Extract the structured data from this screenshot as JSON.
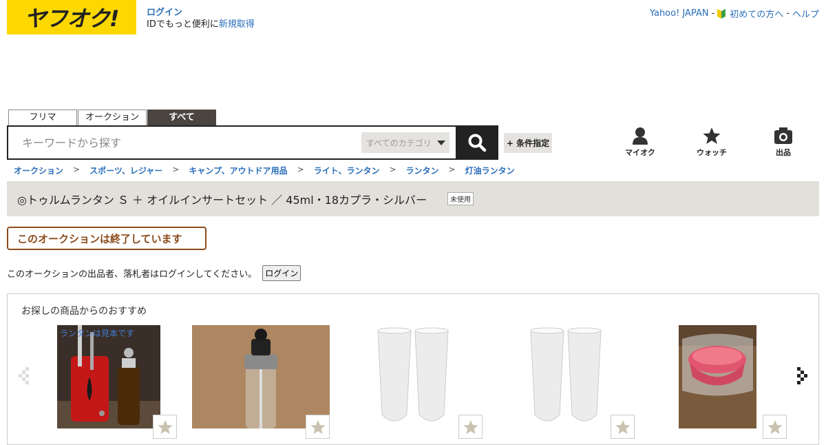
{
  "header": {
    "logo_text": "ヤフオク!",
    "login_label": "ログイン",
    "id_text": "IDでもっと便利に",
    "register_label": "新規取得",
    "top_links": [
      "Yahoo! JAPAN",
      "初めての方へ",
      "ヘルプ"
    ]
  },
  "tabs": [
    {
      "label": "フリマ",
      "active": false
    },
    {
      "label": "オークション",
      "active": false
    },
    {
      "label": "すべて",
      "active": true
    }
  ],
  "search": {
    "placeholder": "キーワードから探す",
    "category": "すべてのカテゴリ",
    "condition_label": "+ 条件指定"
  },
  "rightnav": [
    {
      "label": "マイオク",
      "icon": "person-icon"
    },
    {
      "label": "ウォッチ",
      "icon": "star-icon"
    },
    {
      "label": "出品",
      "icon": "camera-icon"
    }
  ],
  "breadcrumb": [
    "オークション",
    "スポーツ、レジャー",
    "キャンプ、アウトドア用品",
    "ライト、ランタン",
    "ランタン",
    "灯油ランタン"
  ],
  "item": {
    "title": "◎トゥルムランタン Ｓ ＋ オイルインサートセット ／ 45ml・18カプラ・シルバー",
    "condition_badge": "未使用"
  },
  "ended_label": "このオークションは終了しています",
  "notice": {
    "text": "このオークションの出品者、落札者はログインしてください。",
    "button": "ログイン"
  },
  "recommendations": {
    "title": "お探しの商品からのおすすめ",
    "items": [
      {
        "caption": "ランタンは見本です"
      },
      {
        "caption": ""
      },
      {
        "caption": ""
      },
      {
        "caption": ""
      },
      {
        "caption": ""
      }
    ]
  },
  "colors": {
    "brand_yellow": "#fcd800",
    "link_blue": "#2a6ebb",
    "ended_brown": "#8a4b1b",
    "title_band": "#e2e0db"
  }
}
